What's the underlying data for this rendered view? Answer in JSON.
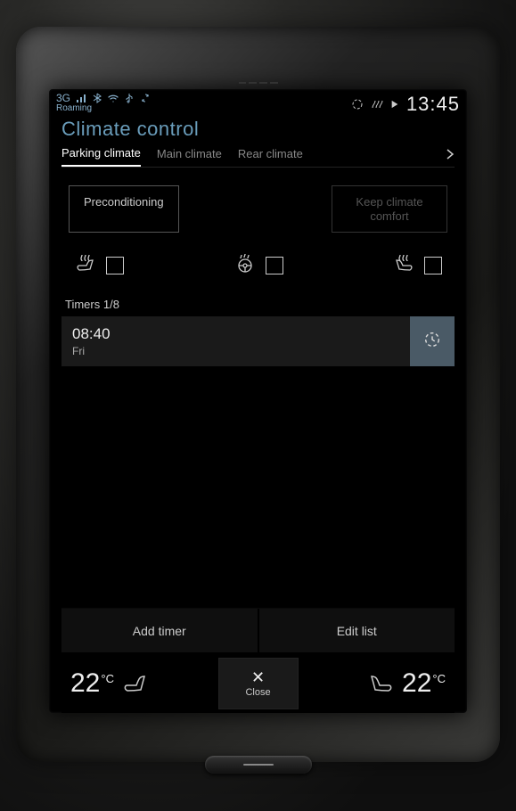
{
  "status": {
    "network": "3G",
    "roaming": "Roaming",
    "clock": "13:45",
    "icons": [
      "signal",
      "bluetooth",
      "wifi",
      "usb",
      "sync",
      "loop",
      "defrost",
      "play"
    ]
  },
  "header": {
    "title": "Climate control",
    "tabs": [
      {
        "label": "Parking climate",
        "active": true
      },
      {
        "label": "Main climate",
        "active": false
      },
      {
        "label": "Rear climate",
        "active": false
      }
    ]
  },
  "buttons": {
    "preconditioning": "Preconditioning",
    "keep_comfort": "Keep climate comfort"
  },
  "checks": {
    "left_seat_heat": false,
    "steering_wheel_heat": false,
    "right_seat_heat": false
  },
  "timers": {
    "label": "Timers 1/8",
    "items": [
      {
        "time": "08:40",
        "day": "Fri"
      }
    ]
  },
  "actions": {
    "add": "Add timer",
    "edit": "Edit list"
  },
  "climate_bar": {
    "left_temp_value": "22",
    "left_temp_unit": "°C",
    "right_temp_value": "22",
    "right_temp_unit": "°C",
    "close": "Close"
  }
}
